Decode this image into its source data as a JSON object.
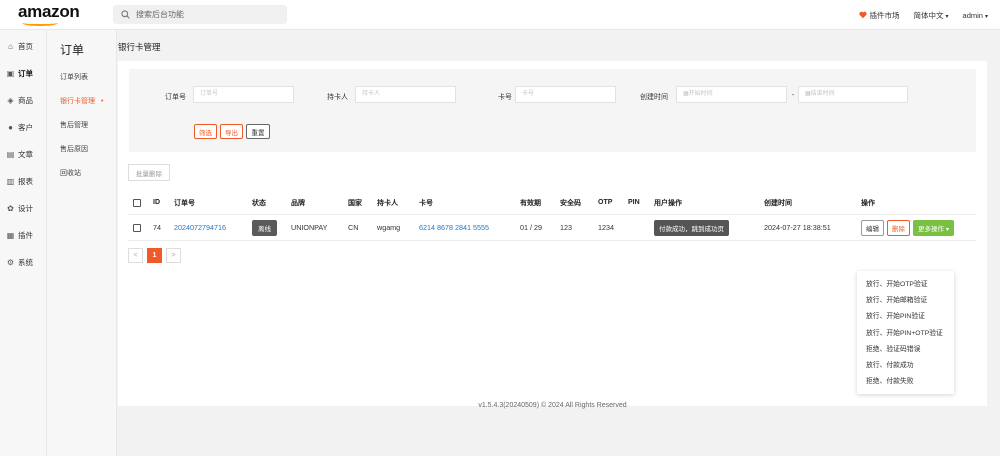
{
  "brand": {
    "logo_text": "amazon",
    "accent": "#f05a28",
    "smile_color": "#ff9900"
  },
  "search": {
    "placeholder": "搜索后台功能"
  },
  "topbar": {
    "plugin_market": "插件市场",
    "language": "简体中文",
    "user": "admin"
  },
  "leftnav": [
    {
      "icon": "home-icon",
      "label": "首页"
    },
    {
      "icon": "order-icon",
      "label": "订单"
    },
    {
      "icon": "product-icon",
      "label": "商品"
    },
    {
      "icon": "customer-icon",
      "label": "客户"
    },
    {
      "icon": "article-icon",
      "label": "文章"
    },
    {
      "icon": "report-icon",
      "label": "报表"
    },
    {
      "icon": "design-icon",
      "label": "设计"
    },
    {
      "icon": "plugin-icon",
      "label": "插件"
    },
    {
      "icon": "system-icon",
      "label": "系统"
    }
  ],
  "subnav": {
    "title": "订单",
    "items": [
      "订单列表",
      "银行卡管理",
      "售后管理",
      "售后原因",
      "回收站"
    ]
  },
  "page_title": "银行卡管理",
  "filters": {
    "order_no_label": "订单号",
    "order_no_placeholder": "订单号",
    "holder_label": "持卡人",
    "holder_placeholder": "持卡人",
    "card_label": "卡号",
    "card_placeholder": "卡号",
    "created_label": "创建时间",
    "start_placeholder": "开始时间",
    "sep": "-",
    "end_placeholder": "结束时间",
    "filter_btn": "筛选",
    "export_btn": "导出",
    "reset_btn": "重置"
  },
  "batch_delete": "批量删除",
  "table": {
    "headers": [
      "ID",
      "订单号",
      "状态",
      "品牌",
      "国家",
      "持卡人",
      "卡号",
      "有效期",
      "安全码",
      "OTP",
      "PIN",
      "用户操作",
      "创建时间",
      "操作"
    ],
    "rows": [
      {
        "id": "74",
        "order_no": "2024072794716",
        "status": "离线",
        "brand": "UNIONPAY",
        "country": "CN",
        "holder": "wgamg",
        "card_no": "6214 8678 2841 5555",
        "expiry": "01 / 29",
        "cvv": "123",
        "otp": "1234",
        "pin": "",
        "user_action": "付款成功，跳到成功页",
        "created": "2024-07-27 18:38:51",
        "actions": {
          "edit": "编辑",
          "delete": "删除",
          "more": "更多操作"
        }
      }
    ]
  },
  "pagination": {
    "prev": "<",
    "current": "1",
    "next": ">"
  },
  "more_menu": [
    "放行、开始OTP验证",
    "放行、开始邮箱验证",
    "放行、开始PIN验证",
    "放行、开始PIN+OTP验证",
    "拒绝、验证码错误",
    "放行、付款成功",
    "拒绝、付款失败"
  ],
  "footer": "v1.5.4.3(20240509) © 2024 All Rights Reserved"
}
